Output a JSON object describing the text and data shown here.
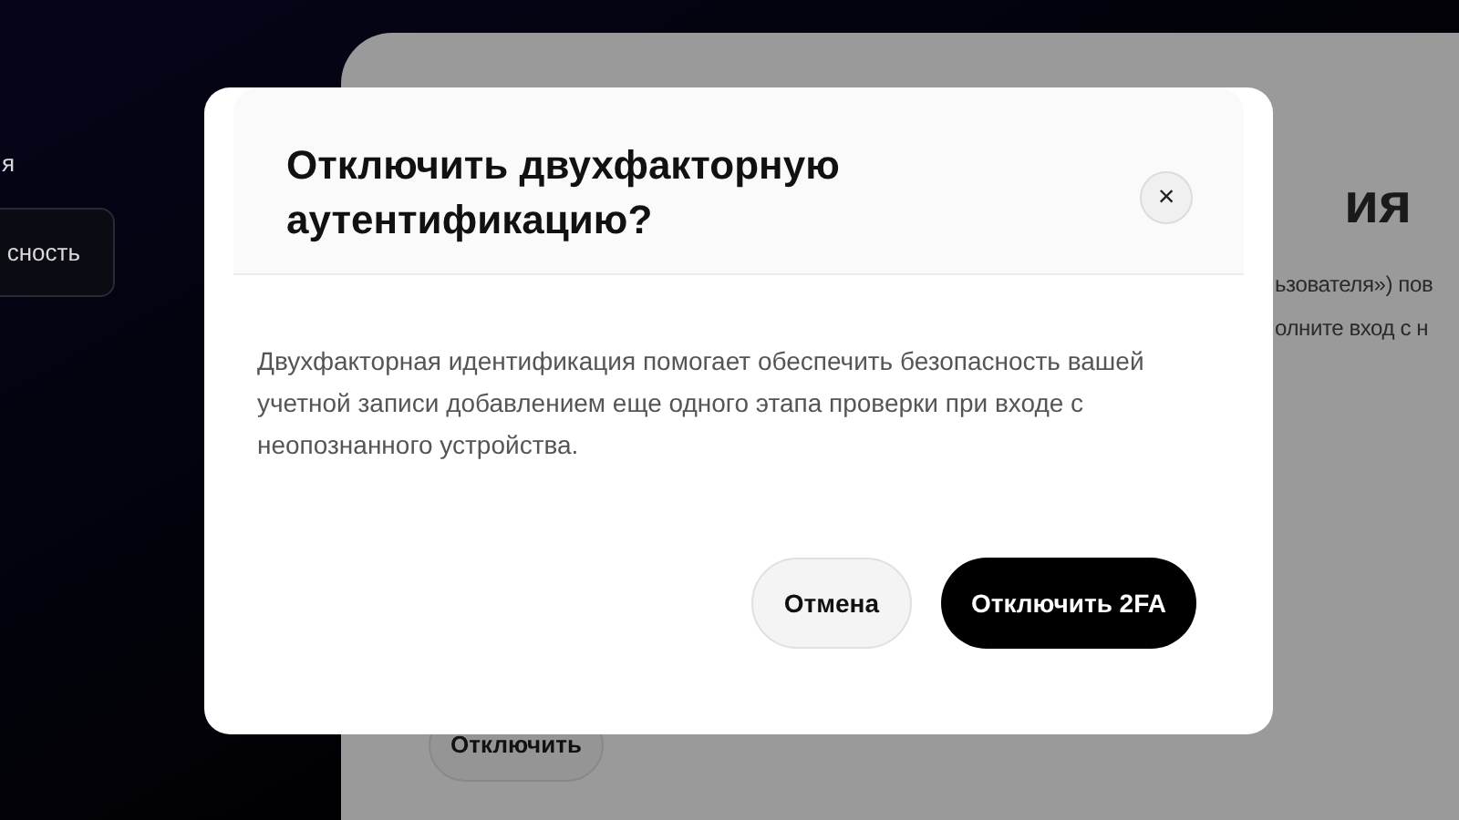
{
  "sidebar": {
    "items": [
      {
        "label": "я",
        "selected": false
      },
      {
        "label": "сность",
        "selected": true
      }
    ]
  },
  "page": {
    "heading": "ия",
    "lines": [
      "ьзователя») пов",
      "олните вход с н"
    ],
    "button": "Отключить"
  },
  "dialog": {
    "title": "Отключить двухфакторную аутентификацию?",
    "close": "×",
    "body": "Двухфакторная идентификация помогает обеспечить безопасность вашей учетной записи добавлением еще одного этапа проверки при входе с неопознанного устройства.",
    "cancel": "Отмена",
    "confirm": "Отключить 2FA"
  }
}
